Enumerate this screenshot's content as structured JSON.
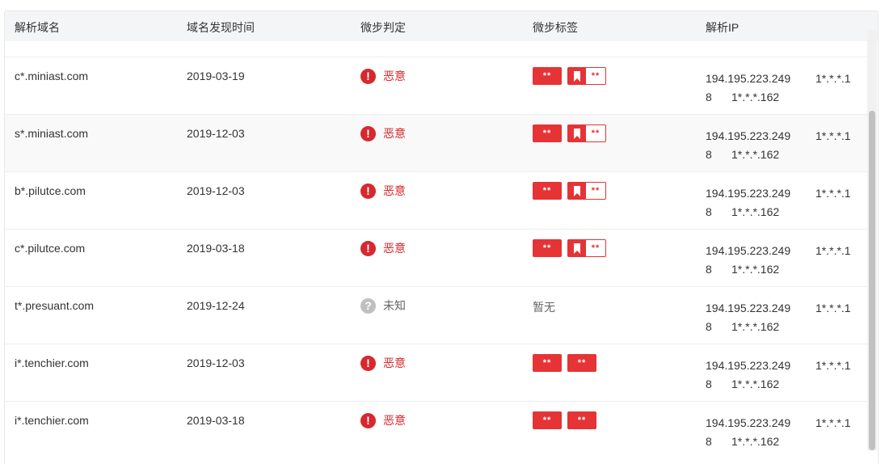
{
  "header": {
    "domain": "解析域名",
    "found_time": "域名发现时间",
    "verdict": "微步判定",
    "tags": "微步标签",
    "ip": "解析IP"
  },
  "rows": [
    {
      "domain": "c*.miniast.com",
      "date": "2019-03-19",
      "verdict": "恶意",
      "verdict_type": "malicious",
      "tags": [
        "**"
      ],
      "bookmark_tag": "**",
      "tag_none": "",
      "ip1": "194.195.223.249",
      "ip2": "1*.*.*.1",
      "ip3": "8",
      "ip4": "1*.*.*.162"
    },
    {
      "domain": "s*.miniast.com",
      "date": "2019-12-03",
      "verdict": "恶意",
      "verdict_type": "malicious",
      "tags": [
        "**"
      ],
      "bookmark_tag": "**",
      "tag_none": "",
      "ip1": "194.195.223.249",
      "ip2": "1*.*.*.1",
      "ip3": "8",
      "ip4": "1*.*.*.162"
    },
    {
      "domain": "b*.pilutce.com",
      "date": "2019-12-03",
      "verdict": "恶意",
      "verdict_type": "malicious",
      "tags": [
        "**"
      ],
      "bookmark_tag": "**",
      "tag_none": "",
      "ip1": "194.195.223.249",
      "ip2": "1*.*.*.1",
      "ip3": "8",
      "ip4": "1*.*.*.162"
    },
    {
      "domain": "c*.pilutce.com",
      "date": "2019-03-18",
      "verdict": "恶意",
      "verdict_type": "malicious",
      "tags": [
        "**"
      ],
      "bookmark_tag": "**",
      "tag_none": "",
      "ip1": "194.195.223.249",
      "ip2": "1*.*.*.1",
      "ip3": "8",
      "ip4": "1*.*.*.162"
    },
    {
      "domain": "t*.presuant.com",
      "date": "2019-12-24",
      "verdict": "未知",
      "verdict_type": "unknown",
      "tags": [],
      "bookmark_tag": "",
      "tag_none": "暂无",
      "ip1": "194.195.223.249",
      "ip2": "1*.*.*.1",
      "ip3": "8",
      "ip4": "1*.*.*.162"
    },
    {
      "domain": "i*.tenchier.com",
      "date": "2019-12-03",
      "verdict": "恶意",
      "verdict_type": "malicious",
      "tags": [
        "**",
        "**"
      ],
      "bookmark_tag": "",
      "tag_none": "",
      "ip1": "194.195.223.249",
      "ip2": "1*.*.*.1",
      "ip3": "8",
      "ip4": "1*.*.*.162"
    },
    {
      "domain": "i*.tenchier.com",
      "date": "2019-03-18",
      "verdict": "恶意",
      "verdict_type": "malicious",
      "tags": [
        "**",
        "**"
      ],
      "bookmark_tag": "",
      "tag_none": "",
      "ip1": "194.195.223.249",
      "ip2": "1*.*.*.1",
      "ip3": "8",
      "ip4": "1*.*.*.162"
    }
  ],
  "colors": {
    "malicious": "#d7282e",
    "tag": "#e63335",
    "unknown": "#bfbfbf",
    "header_bg": "#f4f5f7"
  },
  "icons": {
    "malicious": "exclamation-circle-icon",
    "unknown": "question-circle-icon",
    "bookmark": "bookmark-icon"
  }
}
